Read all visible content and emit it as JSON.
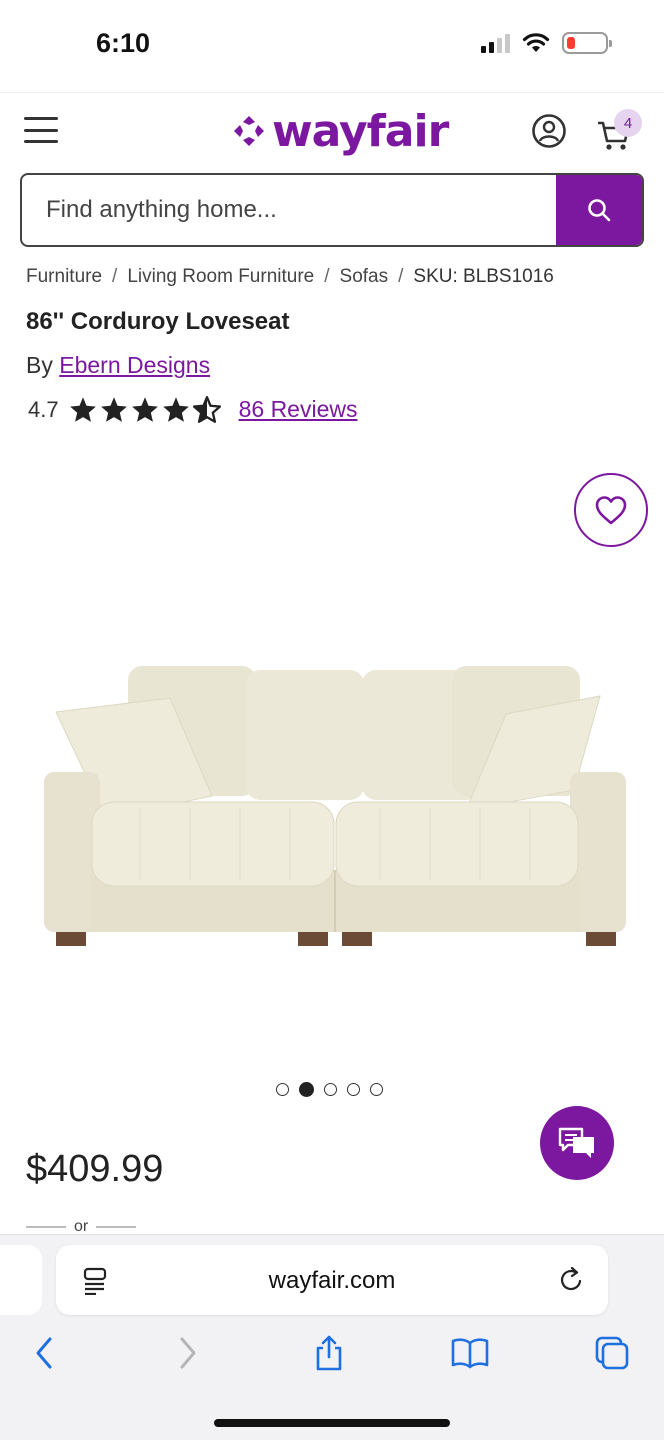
{
  "status_bar": {
    "time": "6:10"
  },
  "header": {
    "logo_text": "wayfair",
    "cart_count": "4"
  },
  "search": {
    "placeholder": "Find anything home..."
  },
  "breadcrumb": {
    "items": [
      "Furniture",
      "Living Room Furniture",
      "Sofas"
    ],
    "separator": "/",
    "sku": "SKU: BLBS1016"
  },
  "product": {
    "title": "86'' Corduroy Loveseat",
    "by_label": "By",
    "brand": "Ebern Designs",
    "rating": "4.7",
    "rating_stars": 4.7,
    "reviews_link": "86 Reviews",
    "price": "$409.99",
    "or_label": "or",
    "image_count": 5,
    "active_image": 2
  },
  "browser": {
    "url": "wayfair.com"
  },
  "colors": {
    "brand_purple": "#7b189f",
    "cushion_fabric": "#ebe7d6",
    "sofa_legs": "#6b4a36"
  },
  "icons": {
    "menu": "hamburger-icon",
    "account": "user-circle-icon",
    "cart": "cart-icon",
    "search": "search-icon",
    "favorite": "heart-icon",
    "chat": "chat-bubbles-icon",
    "reader": "reader-mode-icon",
    "reload": "reload-icon",
    "back": "chevron-left-icon",
    "forward": "chevron-right-icon",
    "share": "share-icon",
    "bookmarks": "book-icon",
    "tabs": "tabs-icon"
  }
}
